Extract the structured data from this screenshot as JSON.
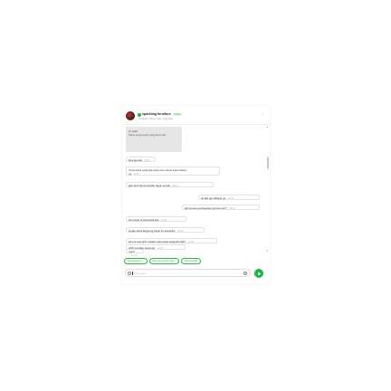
{
  "header": {
    "shop_name": "sparkling furniture",
    "online_badge": "Online",
    "status": "Terakhir online 1 jam yang lalu"
  },
  "quoted": {
    "line1": "Hi, Halo!",
    "line2": "Kamu punya stock yang kamu cari"
  },
  "messages": [
    {
      "text": "bisa aja kak",
      "time": "12:11",
      "direction": "in"
    },
    {
      "text": "cuma stock yang ada yang mau mama ingin dukasi",
      "text2": "ya",
      "time": "12:11",
      "direction": "in"
    },
    {
      "text": "jadi nanti harus transfer bayar sesuai",
      "time": "12:11",
      "direction": "in"
    },
    {
      "text": "ok kak gitu dibayar ya",
      "time": "12:13",
      "direction": "out"
    },
    {
      "text": "jadi proses pembayaran gimana min?",
      "time": "12:13",
      "direction": "out"
    },
    {
      "text": "kan bayar di tokopedia kak",
      "time": "12:14",
      "direction": "in"
    },
    {
      "text": "engak sama langsung bayar ke ekspedisi",
      "time": "12:14",
      "direction": "in"
    },
    {
      "text": "kan ini mau kirim lewatin atau lewat ekspedisi kak?",
      "time": "12:14",
      "direction": "in"
    },
    {
      "text": "mau?",
      "time": "12:14",
      "direction": "in"
    },
    {
      "text": "lebih ok kalau lewat aja",
      "time": "12:15",
      "direction": "in"
    }
  ],
  "chips": [
    "Cek barang ini...",
    "Mau tanya lebih dulu...",
    "Terima kasih"
  ],
  "input": {
    "placeholder": "Tulis pesan..."
  },
  "icons": {
    "avatar": "shop-avatar",
    "check": "verified-check-icon",
    "menu": "more-vertical-icon",
    "emoji": "emoji-icon",
    "attach": "attach-icon",
    "send": "send-icon"
  },
  "colors": {
    "accent": "#23b240"
  }
}
